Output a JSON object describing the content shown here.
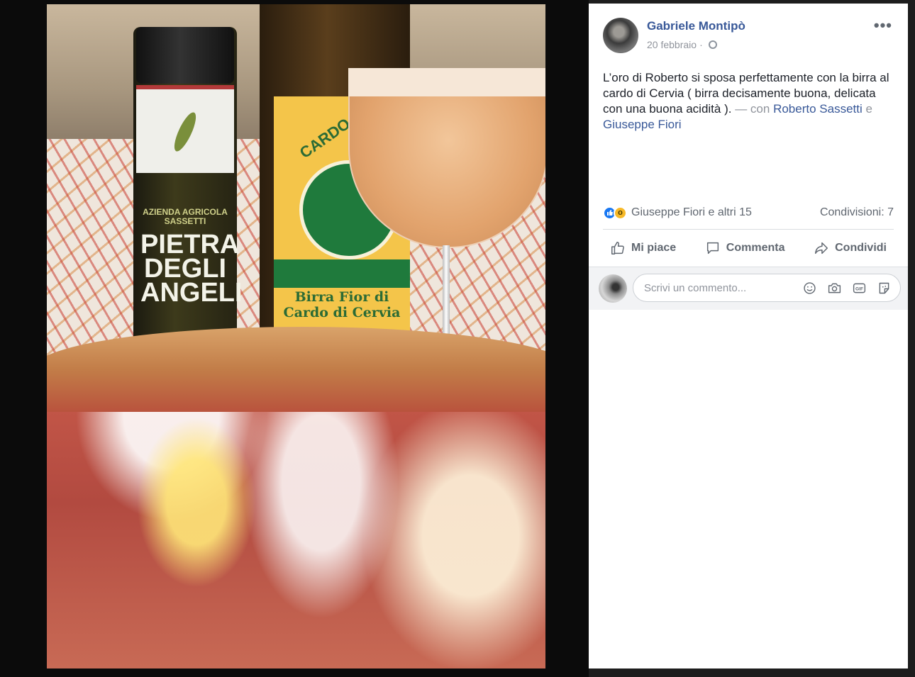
{
  "post": {
    "author": "Gabriele Montipò",
    "date": "20 febbraio",
    "date_separator": "·",
    "text_main": "L’oro di Roberto si sposa perfettamente con la birra al cardo di Cervia ( birra decisamente buona, delicata con una buona acidità ).",
    "text_with": "— con",
    "tag1": "Roberto Sassetti",
    "text_and": "e",
    "tag2": "Giuseppe Fiori",
    "reactions_names": "Giuseppe Fiori e altri 15",
    "shares": "Condivisioni: 7"
  },
  "actions": {
    "like": "Mi piace",
    "comment": "Commenta",
    "share": "Condividi"
  },
  "comment": {
    "placeholder": "Scrivi un commento..."
  },
  "photo": {
    "oil_brand_small": "AZIENDA AGRICOLA SASSETTI",
    "oil_brand": "PIETRA DEGLI ANGELI",
    "beer_arc": "CARDO D",
    "beer_label": "Birra Fior di Cardo di Cervia"
  },
  "icons": {
    "like_reaction": "thumbs-up-icon",
    "wow_reaction": "wow-icon",
    "more": "more-options-icon",
    "privacy": "globe-icon"
  },
  "colors": {
    "link": "#385898",
    "like_blue": "#1877f2",
    "wow_yellow": "#f7b928"
  }
}
